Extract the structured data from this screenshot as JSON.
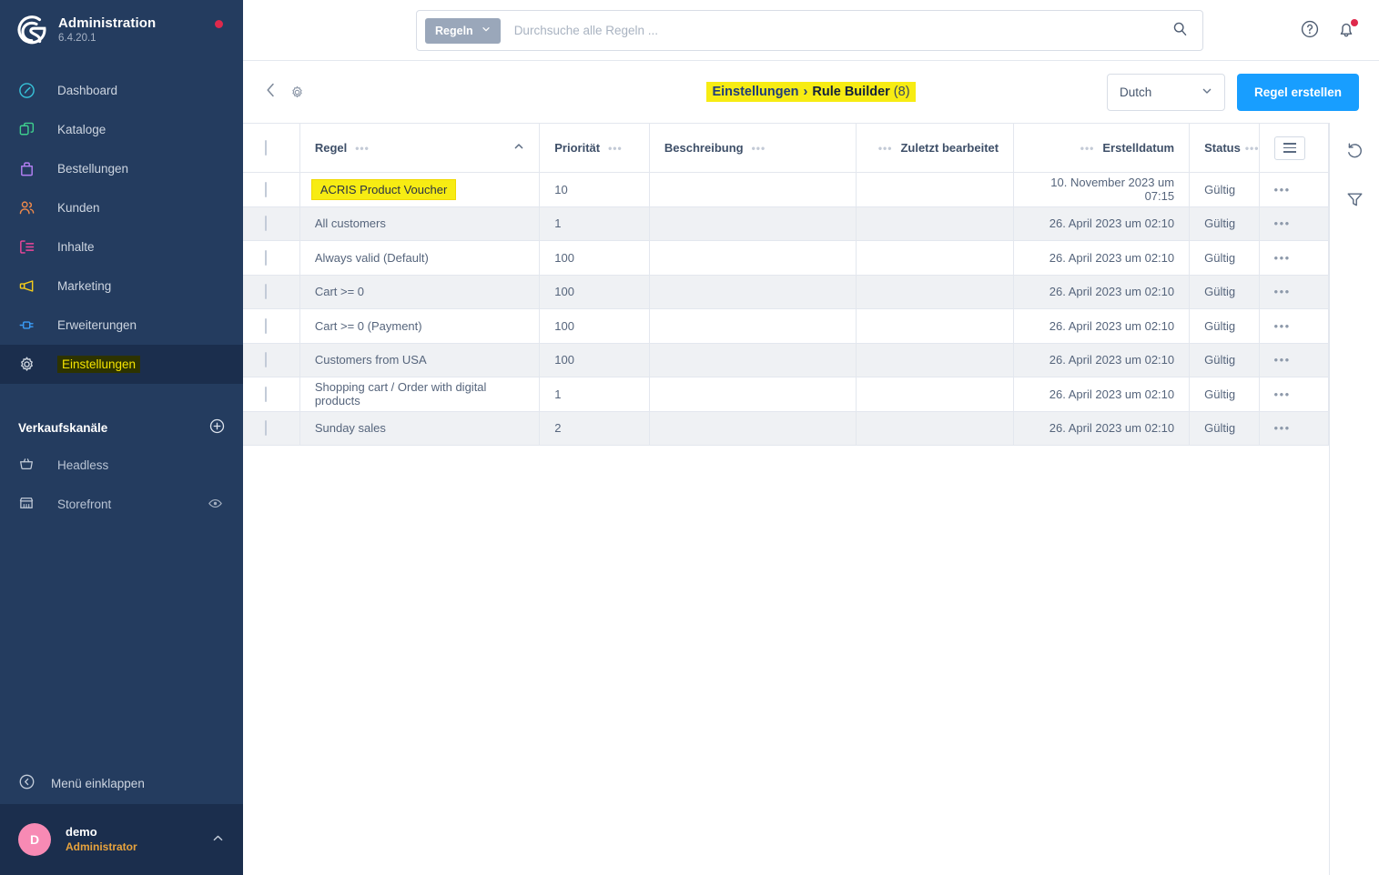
{
  "brand": {
    "title": "Administration",
    "version": "6.4.20.1",
    "logo_icon": "shopware-logo-icon",
    "status_dot_icon": "update-available-dot-icon",
    "status_dot_color": "#de294c"
  },
  "sidebar": {
    "items": [
      {
        "label": "Dashboard",
        "icon": "dashboard-gauge-icon",
        "color": "#37c2d9",
        "active": false
      },
      {
        "label": "Kataloge",
        "icon": "catalog-layers-icon",
        "color": "#3ecf8e",
        "active": false
      },
      {
        "label": "Bestellungen",
        "icon": "orders-bag-icon",
        "color": "#b580f5",
        "active": false
      },
      {
        "label": "Kunden",
        "icon": "customers-people-icon",
        "color": "#f08a4b",
        "active": false
      },
      {
        "label": "Inhalte",
        "icon": "content-list-icon",
        "color": "#f0469b",
        "active": false
      },
      {
        "label": "Marketing",
        "icon": "marketing-megaphone-icon",
        "color": "#f5cc1a",
        "active": false
      },
      {
        "label": "Erweiterungen",
        "icon": "extensions-plug-icon",
        "color": "#3a9bf5",
        "active": false
      },
      {
        "label": "Einstellungen",
        "icon": "settings-gear-icon",
        "color": "#ccd3dd",
        "active": true,
        "highlighted": true
      }
    ],
    "sales_channels": {
      "title": "Verkaufskanäle",
      "add_icon": "plus-circle-icon",
      "items": [
        {
          "label": "Headless",
          "icon": "headless-basket-icon",
          "trailing_icon": ""
        },
        {
          "label": "Storefront",
          "icon": "storefront-shop-icon",
          "trailing_icon": "eye-icon"
        }
      ]
    },
    "collapse": {
      "label": "Menü einklappen",
      "icon": "chevron-left-circle-icon"
    },
    "user": {
      "initial": "D",
      "name": "demo",
      "role": "Administrator",
      "avatar_color": "#f78ab4",
      "caret_icon": "chevron-up-icon"
    }
  },
  "topbar": {
    "search": {
      "scope_label": "Regeln",
      "scope_caret_icon": "chevron-down-icon",
      "placeholder": "Durchsuche alle Regeln ...",
      "value": "",
      "search_icon": "search-magnifier-icon"
    },
    "help_icon": "help-question-circle-icon",
    "notifications_icon": "notification-bell-icon",
    "notifications_dot_color": "#de294c"
  },
  "subbar": {
    "back_icon": "chevron-left-icon",
    "settings_icon": "gear-icon",
    "breadcrumb": {
      "parent": "Einstellungen",
      "separator": "›",
      "current": "Rule Builder",
      "count": "(8)",
      "highlight_color": "#f7ec13"
    },
    "language": {
      "value": "Dutch",
      "caret_icon": "chevron-down-icon"
    },
    "create_button": {
      "label": "Regel erstellen",
      "color": "#189eff"
    }
  },
  "table": {
    "select_all_checkbox": "select-all-checkbox",
    "columns": [
      {
        "key": "rule",
        "label": "Regel",
        "sorted": true,
        "sort_icon": "caret-up-icon"
      },
      {
        "key": "priority",
        "label": "Priorität"
      },
      {
        "key": "description",
        "label": "Beschreibung"
      },
      {
        "key": "lastEdited",
        "label": "Zuletzt bearbeitet"
      },
      {
        "key": "created",
        "label": "Erstelldatum"
      },
      {
        "key": "status",
        "label": "Status"
      }
    ],
    "settings_icon": "table-columns-hamburger-icon",
    "row_action_icon": "context-menu-dots-icon",
    "rows": [
      {
        "rule": "ACRIS Product Voucher",
        "priority": "10",
        "description": "",
        "lastEdited": "",
        "created": "10. November 2023 um 07:15",
        "status": "Gültig",
        "highlighted": true
      },
      {
        "rule": "All customers",
        "priority": "1",
        "description": "",
        "lastEdited": "",
        "created": "26. April 2023 um 02:10",
        "status": "Gültig",
        "highlighted": false
      },
      {
        "rule": "Always valid (Default)",
        "priority": "100",
        "description": "",
        "lastEdited": "",
        "created": "26. April 2023 um 02:10",
        "status": "Gültig",
        "highlighted": false
      },
      {
        "rule": "Cart >= 0",
        "priority": "100",
        "description": "",
        "lastEdited": "",
        "created": "26. April 2023 um 02:10",
        "status": "Gültig",
        "highlighted": false
      },
      {
        "rule": "Cart >= 0 (Payment)",
        "priority": "100",
        "description": "",
        "lastEdited": "",
        "created": "26. April 2023 um 02:10",
        "status": "Gültig",
        "highlighted": false
      },
      {
        "rule": "Customers from USA",
        "priority": "100",
        "description": "",
        "lastEdited": "",
        "created": "26. April 2023 um 02:10",
        "status": "Gültig",
        "highlighted": false
      },
      {
        "rule": "Shopping cart / Order with digital products",
        "priority": "1",
        "description": "",
        "lastEdited": "",
        "created": "26. April 2023 um 02:10",
        "status": "Gültig",
        "highlighted": false
      },
      {
        "rule": "Sunday sales",
        "priority": "2",
        "description": "",
        "lastEdited": "",
        "created": "26. April 2023 um 02:10",
        "status": "Gültig",
        "highlighted": false
      }
    ]
  },
  "rightrail": {
    "refresh_icon": "refresh-undo-icon",
    "filter_icon": "filter-funnel-icon"
  }
}
